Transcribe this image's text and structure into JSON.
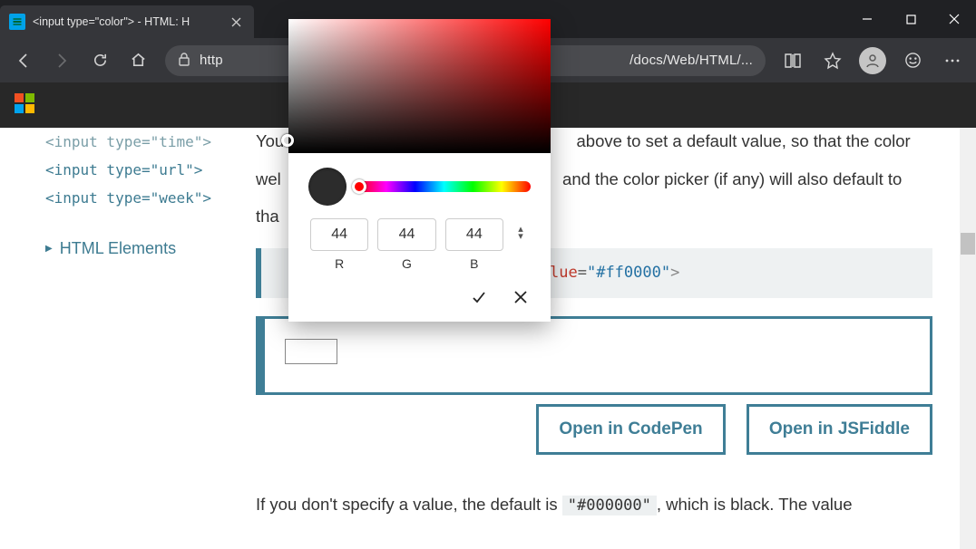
{
  "window": {
    "tab_title": "<input type=\"color\"> - HTML: H"
  },
  "toolbar": {
    "url_visible_left": "http",
    "url_visible_right": "/docs/Web/HTML/..."
  },
  "sidebar": {
    "items": [
      "<input type=\"time\">",
      "<input type=\"url\">",
      "<input type=\"week\">"
    ],
    "section_link": "HTML Elements"
  },
  "article": {
    "p1_pre": "You",
    "p1_mid": "above to set a default value, so that the color",
    "p2_pre": "wel",
    "p2_mid": "and the color picker (if any) will also default to",
    "p3": "tha",
    "code_attr_value_part": "lue",
    "code_eq": "=",
    "code_val": "\"#ff0000\"",
    "code_close": ">",
    "open_codepen": "Open in CodePen",
    "open_jsfiddle": "Open in JSFiddle",
    "tail_pre": "If you don't specify a value, the default is ",
    "tail_code": "\"#000000\"",
    "tail_post": ", which is black. The value"
  },
  "picker": {
    "r": "44",
    "g": "44",
    "b": "44",
    "label_r": "R",
    "label_g": "G",
    "label_b": "B"
  }
}
